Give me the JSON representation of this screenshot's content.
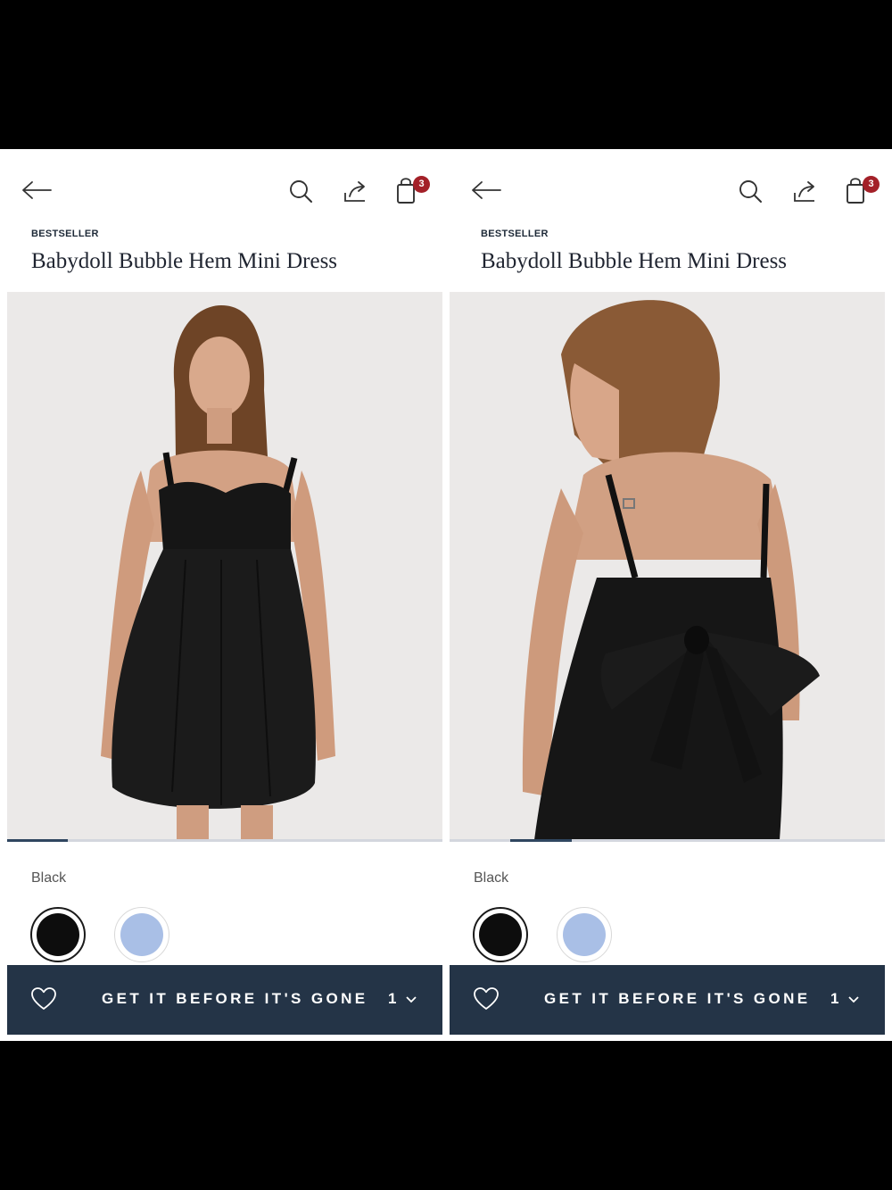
{
  "screens": [
    {
      "nav": {
        "back_icon": "arrow-left-icon",
        "search_icon": "search-icon",
        "share_icon": "share-icon",
        "bag_icon": "shopping-bag-icon",
        "bag_count": "3"
      },
      "product": {
        "eyebrow": "BESTSELLER",
        "title": "Babydoll Bubble Hem Mini Dress"
      },
      "gallery": {
        "view": "front",
        "image_position": 0.14
      },
      "color": {
        "label": "Black",
        "options": [
          {
            "name": "black",
            "hex": "#0d0d0d",
            "selected": true
          },
          {
            "name": "light-blue",
            "hex": "#a9bfe6",
            "selected": false
          }
        ]
      },
      "cta": {
        "wishlist_icon": "heart-icon",
        "label": "GET IT BEFORE IT'S GONE",
        "quantity": "1"
      }
    },
    {
      "nav": {
        "back_icon": "arrow-left-icon",
        "search_icon": "search-icon",
        "share_icon": "share-icon",
        "bag_icon": "shopping-bag-icon",
        "bag_count": "3"
      },
      "product": {
        "eyebrow": "BESTSELLER",
        "title": "Babydoll Bubble Hem Mini Dress"
      },
      "gallery": {
        "view": "back",
        "image_position": 0.14
      },
      "color": {
        "label": "Black",
        "options": [
          {
            "name": "black",
            "hex": "#0d0d0d",
            "selected": true
          },
          {
            "name": "light-blue",
            "hex": "#a9bfe6",
            "selected": false
          }
        ]
      },
      "cta": {
        "wishlist_icon": "heart-icon",
        "label": "GET IT BEFORE IT'S GONE",
        "quantity": "1"
      }
    }
  ],
  "colors": {
    "cta_background": "#243447",
    "badge": "#a32028",
    "progress": "#2f4660"
  }
}
